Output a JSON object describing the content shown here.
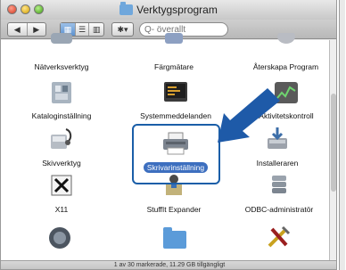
{
  "window": {
    "title": "Verktygsprogram"
  },
  "toolbar": {
    "back_label": "◀",
    "forward_label": "▶",
    "view_icons_label": "▦",
    "view_list_label": "☰",
    "view_columns_label": "▥",
    "action_label": "✱▾",
    "search_placeholder": "Q- överallt"
  },
  "items": [
    {
      "name": "Nätverksverktyg",
      "icon": "network-utility-icon"
    },
    {
      "name": "Färgmätare",
      "icon": "color-meter-icon"
    },
    {
      "name": "Återskapa Program",
      "icon": "restore-program-icon"
    },
    {
      "name": "Kataloginställning",
      "icon": "directory-setup-icon"
    },
    {
      "name": "Systemmeddelanden",
      "icon": "console-icon"
    },
    {
      "name": "Aktivitetskontroll",
      "icon": "activity-monitor-icon"
    },
    {
      "name": "Skivverktyg",
      "icon": "disk-utility-icon"
    },
    {
      "name": "Skrivarinställning",
      "icon": "printer-setup-icon",
      "selected": true
    },
    {
      "name": "Installeraren",
      "icon": "installer-icon"
    },
    {
      "name": "X11",
      "icon": "x11-icon"
    },
    {
      "name": "StuffIt Expander",
      "icon": "stuffit-expander-icon"
    },
    {
      "name": "ODBC-administratör",
      "icon": "odbc-administrator-icon"
    }
  ],
  "status": {
    "text": "1 av 30 markerade, 11.29 GB tillgängligt"
  },
  "colors": {
    "selection_frame": "#1a5ea8",
    "arrow": "#1e5aa8",
    "selection_label_bg": "#3d6fbf"
  }
}
